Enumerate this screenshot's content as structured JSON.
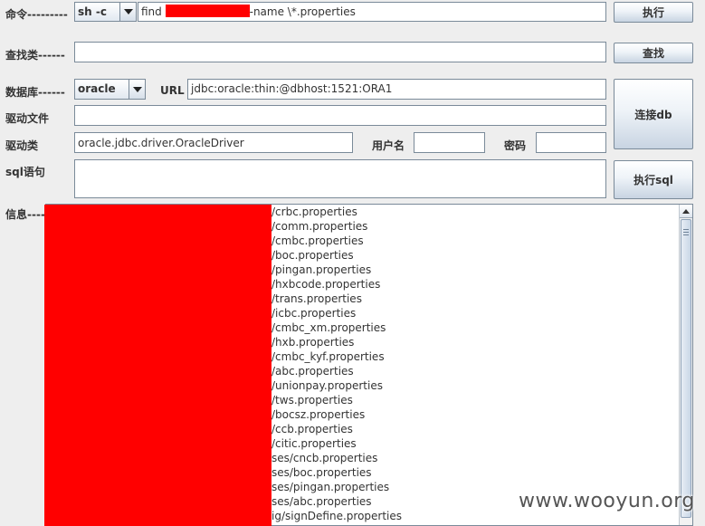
{
  "labels": {
    "command": "命令---------",
    "find": "查找类------",
    "database": "数据库------",
    "url": "URL",
    "driver_file": "驱动文件",
    "driver_class": "驱动类",
    "username": "用户名",
    "password": "密码",
    "sql": "sql语句",
    "info": "信息----"
  },
  "command": {
    "shell_option": "sh -c",
    "input_prefix": "find",
    "input_suffix": "-name \\*.properties",
    "execute_label": "执行"
  },
  "find_row": {
    "input_value": "",
    "button_label": "查找"
  },
  "db": {
    "type": "oracle",
    "url": "jdbc:oracle:thin:@dbhost:1521:ORA1",
    "driver_file": "",
    "driver_class": "oracle.jdbc.driver.OracleDriver",
    "username": "",
    "password": "",
    "connect_label": "连接db"
  },
  "sql": {
    "value": "",
    "execute_label": "执行sql"
  },
  "output_lines": [
    "/crbc.properties",
    "/comm.properties",
    "/cmbc.properties",
    "/boc.properties",
    "/pingan.properties",
    "/hxbcode.properties",
    "/trans.properties",
    "/icbc.properties",
    "/cmbc_xm.properties",
    "/hxb.properties",
    "/cmbc_kyf.properties",
    "/abc.properties",
    "/unionpay.properties",
    "/tws.properties",
    "/bocsz.properties",
    "/ccb.properties",
    "/citic.properties",
    "ses/cncb.properties",
    "ses/boc.properties",
    "ses/pingan.properties",
    "ses/abc.properties",
    "ig/signDefine.properties"
  ],
  "watermark": "www.wooyun.org",
  "colors": {
    "redaction": "#ff0000",
    "background": "#eeeeee"
  }
}
